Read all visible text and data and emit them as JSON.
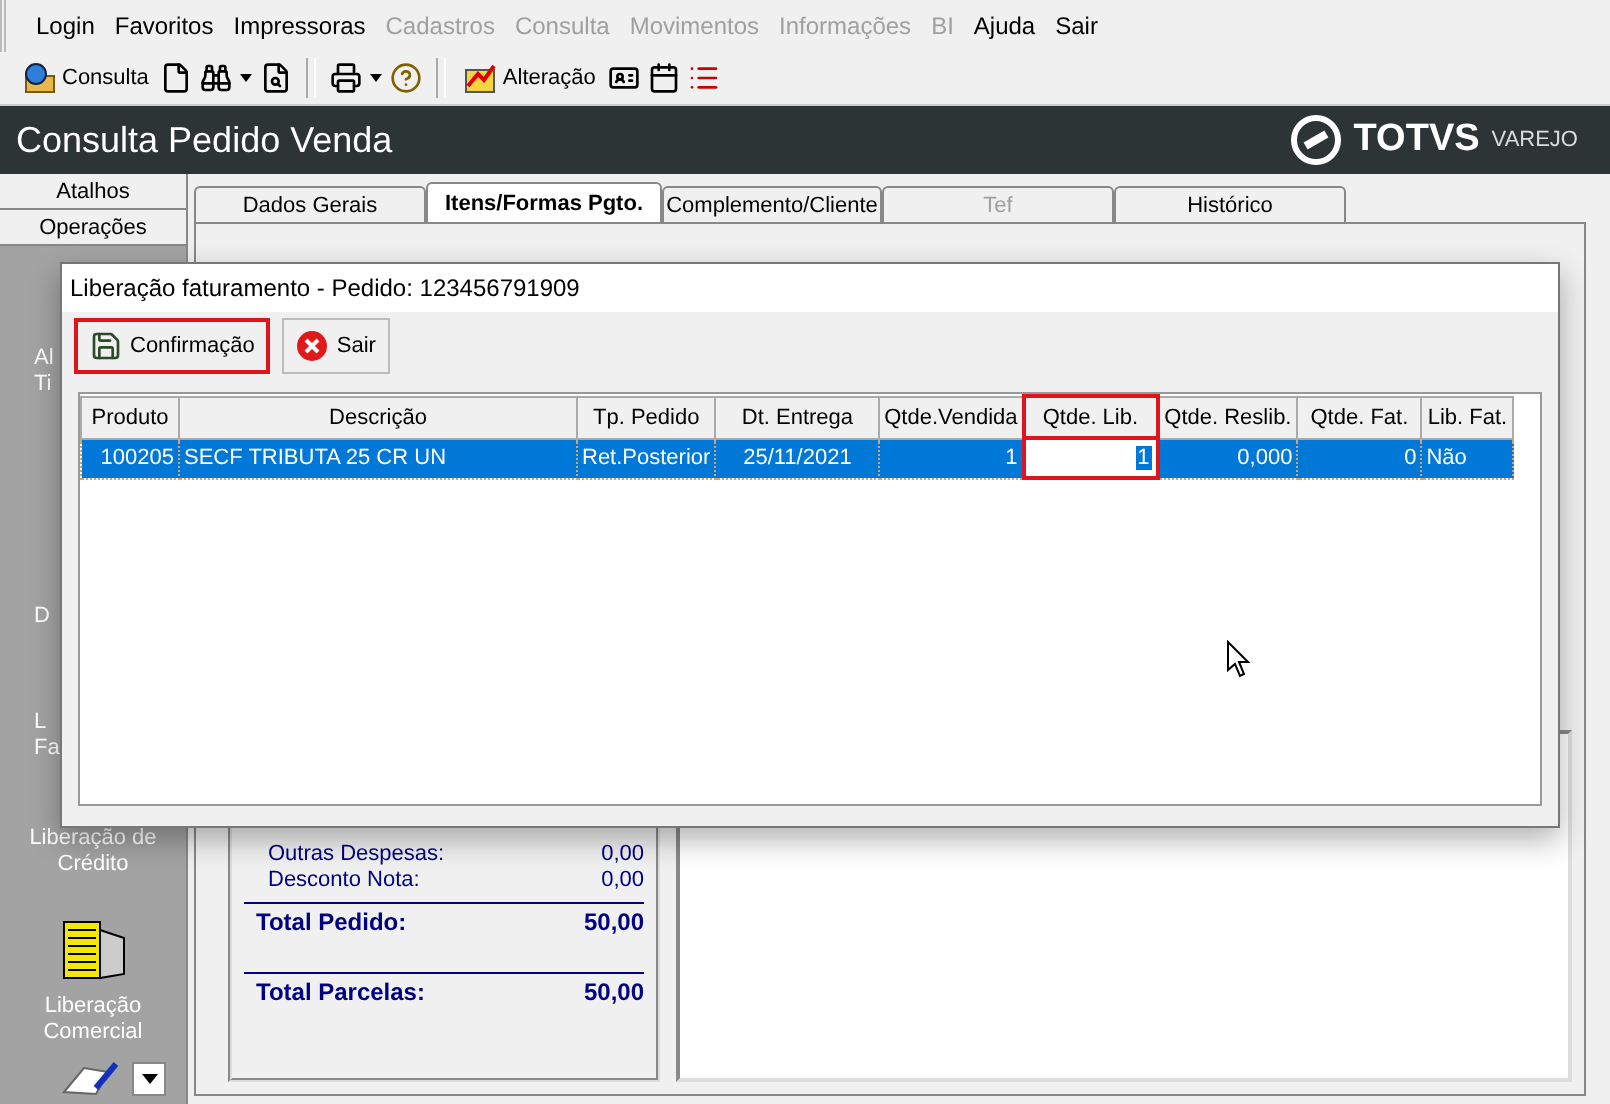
{
  "menu": [
    {
      "label": "Login",
      "disabled": false
    },
    {
      "label": "Favoritos",
      "disabled": false
    },
    {
      "label": "Impressoras",
      "disabled": false
    },
    {
      "label": "Cadastros",
      "disabled": true
    },
    {
      "label": "Consulta",
      "disabled": true
    },
    {
      "label": "Movimentos",
      "disabled": true
    },
    {
      "label": "Informações",
      "disabled": true
    },
    {
      "label": "BI",
      "disabled": true
    },
    {
      "label": "Ajuda",
      "disabled": false
    },
    {
      "label": "Sair",
      "disabled": false
    }
  ],
  "toolbar": {
    "buttons": [
      "Consulta",
      "Alteração"
    ]
  },
  "header": {
    "title": "Consulta Pedido Venda",
    "logo": "TOTVS",
    "logo_suffix": "VAREJO"
  },
  "sidebar": {
    "tabs": [
      "Atalhos",
      "Operações"
    ],
    "items": [
      {
        "kind": "partial",
        "lines": [
          "Al",
          "Ti"
        ]
      },
      {
        "kind": "partial",
        "lines": [
          "D"
        ]
      },
      {
        "kind": "partial",
        "lines": [
          "L",
          "Fa"
        ]
      },
      {
        "kind": "full",
        "lines": [
          "Liberação de",
          "Crédito"
        ]
      },
      {
        "kind": "full",
        "lines": [
          "Liberação",
          "Comercial"
        ]
      }
    ]
  },
  "tabs": [
    {
      "label": "Dados Gerais",
      "selected": false,
      "disabled": false
    },
    {
      "label": "Itens/Formas Pgto.",
      "selected": true,
      "disabled": false
    },
    {
      "label": "Complemento/Cliente",
      "selected": false,
      "disabled": false
    },
    {
      "label": "Tef",
      "selected": false,
      "disabled": true
    },
    {
      "label": "Histórico",
      "selected": false,
      "disabled": false
    }
  ],
  "summary": [
    {
      "label": "Outras Despesas:",
      "value": "0,00",
      "kind": "line"
    },
    {
      "label": "Desconto Nota:",
      "value": "0,00",
      "kind": "line"
    },
    {
      "label": "Total Pedido:",
      "value": "50,00",
      "kind": "total"
    },
    {
      "label": "Total Parcelas:",
      "value": "50,00",
      "kind": "total"
    }
  ],
  "dialog": {
    "title": "Liberação faturamento - Pedido: 123456791909",
    "buttons": [
      {
        "label": "Confirmação",
        "kind": "save",
        "highlighted": true
      },
      {
        "label": "Sair",
        "kind": "exit",
        "highlighted": false
      }
    ],
    "columns": [
      {
        "label": "Produto",
        "highlighted": false
      },
      {
        "label": "Descrição",
        "highlighted": false
      },
      {
        "label": "Tp. Pedido",
        "highlighted": false
      },
      {
        "label": "Dt. Entrega",
        "highlighted": false
      },
      {
        "label": "Qtde.Vendida",
        "highlighted": false
      },
      {
        "label": "Qtde. Lib.",
        "highlighted": true
      },
      {
        "label": "Qtde. Reslib.",
        "highlighted": false
      },
      {
        "label": "Qtde. Fat.",
        "highlighted": false
      },
      {
        "label": "Lib. Fat.",
        "highlighted": false
      }
    ],
    "rows": [
      {
        "selected": true,
        "cells": [
          {
            "kind": "text",
            "text": "100205"
          },
          {
            "kind": "text",
            "text": "SECF TRIBUTA 25  CR UN"
          },
          {
            "kind": "text",
            "text": "Ret.Posterior"
          },
          {
            "kind": "text",
            "text": "25/11/2021"
          },
          {
            "kind": "text",
            "text": "1"
          },
          {
            "kind": "input",
            "text": "1"
          },
          {
            "kind": "text",
            "text": "0,000"
          },
          {
            "kind": "text",
            "text": "0"
          },
          {
            "kind": "text",
            "text": "Não"
          }
        ]
      }
    ]
  }
}
